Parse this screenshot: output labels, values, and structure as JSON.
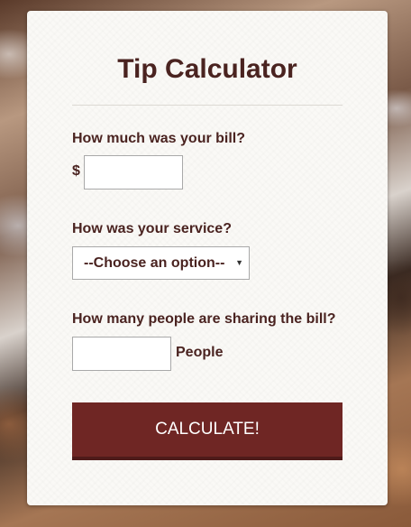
{
  "calculator": {
    "title": "Tip Calculator",
    "bill": {
      "label": "How much was your bill?",
      "currency_symbol": "$",
      "value": ""
    },
    "service": {
      "label": "How was your service?",
      "selected_option": "--Choose an option--"
    },
    "people": {
      "label": "How many people are sharing the bill?",
      "value": "",
      "suffix": "People"
    },
    "calculate_button_label": "CALCULATE!"
  },
  "colors": {
    "heading_text": "#4a2320",
    "button_bg": "#6f2624",
    "card_bg": "#faf9f6"
  }
}
